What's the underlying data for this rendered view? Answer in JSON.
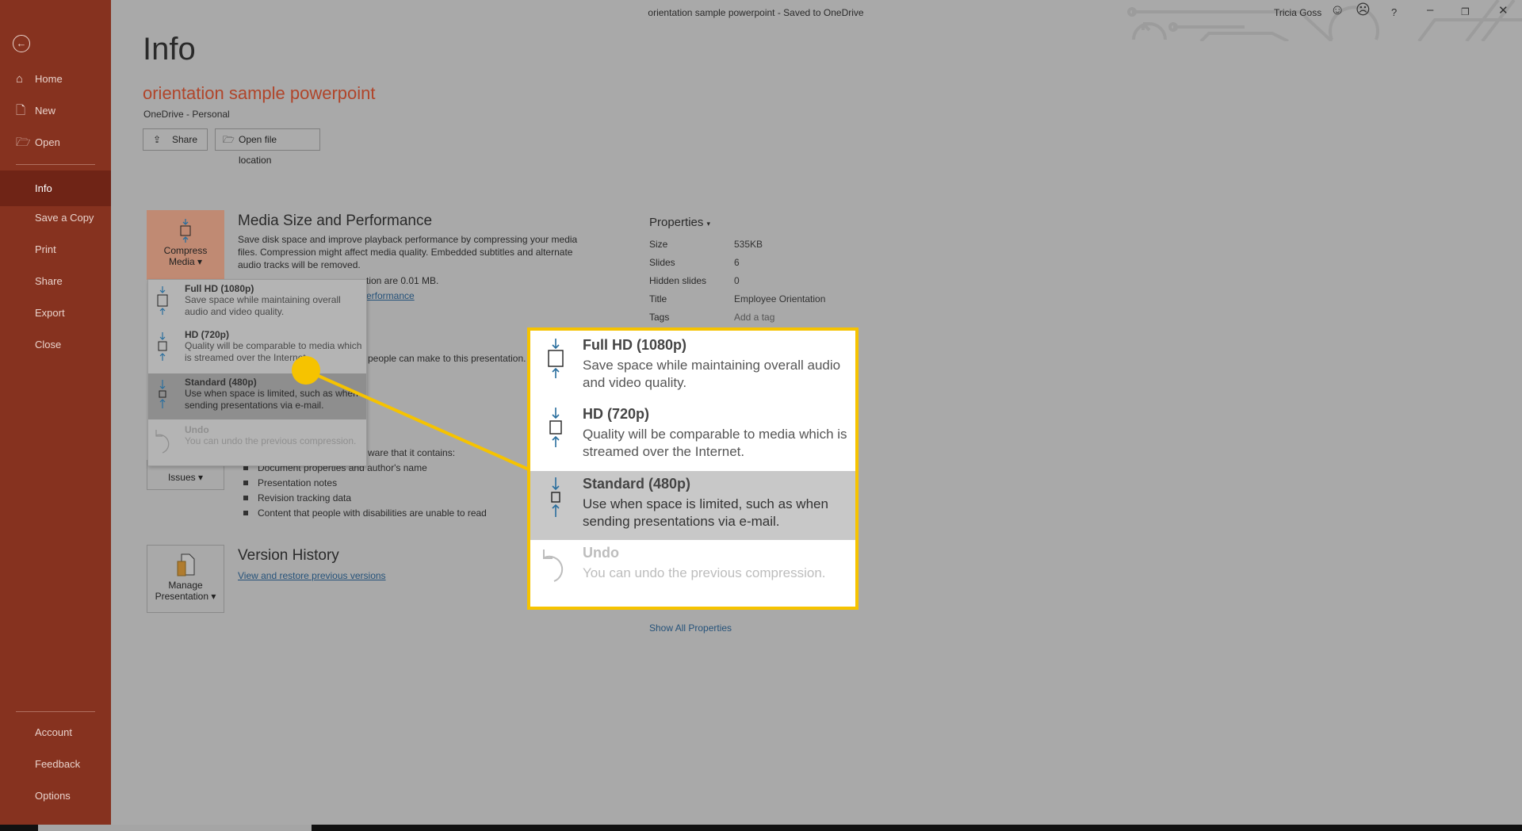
{
  "window": {
    "title": "orientation sample powerpoint  -  Saved to OneDrive",
    "user": "Tricia Goss",
    "help": "?"
  },
  "sidebar": {
    "items": [
      {
        "label": "Home",
        "icon": "home-icon"
      },
      {
        "label": "New",
        "icon": "new-file-icon"
      },
      {
        "label": "Open",
        "icon": "folder-open-icon"
      },
      {
        "label": "Info",
        "selected": true
      },
      {
        "label": "Save a Copy"
      },
      {
        "label": "Print"
      },
      {
        "label": "Share"
      },
      {
        "label": "Export"
      },
      {
        "label": "Close"
      }
    ],
    "bottom": [
      {
        "label": "Account"
      },
      {
        "label": "Feedback"
      },
      {
        "label": "Options"
      }
    ]
  },
  "main": {
    "heading": "Info",
    "doc_name": "orientation sample powerpoint",
    "location": "OneDrive - Personal",
    "share_label": "Share",
    "open_location_label": "Open file location",
    "media": {
      "button": "Compress",
      "button2": "Media",
      "title": "Media Size and Performance",
      "desc": [
        "Save disk space and improve playback performance by compressing your media",
        "files. Compression might affect media quality. Embedded subtitles and alternate",
        "audio tracks will be removed."
      ],
      "size_fragment": "tion are 0.01 MB.",
      "link_fragment": "erformance"
    },
    "protect_fragment": "people can make to this presentation.",
    "inspect": {
      "button": "Issues",
      "intro_fragment": "ware that it contains:",
      "bullets": [
        "Document properties and author's name",
        "Presentation notes",
        "Revision tracking data",
        "Content that people with disabilities are unable to read"
      ]
    },
    "version": {
      "button": "Manage",
      "button2": "Presentation",
      "title": "Version History",
      "link": "View and restore previous versions"
    }
  },
  "properties": {
    "title": "Properties",
    "rows": [
      {
        "label": "Size",
        "value": "535KB"
      },
      {
        "label": "Slides",
        "value": "6"
      },
      {
        "label": "Hidden slides",
        "value": "0"
      },
      {
        "label": "Title",
        "value": "Employee Orientation"
      },
      {
        "label": "Tags",
        "value": "Add a tag"
      }
    ],
    "show_all": "Show All Properties"
  },
  "compress_menu": {
    "items": [
      {
        "title": "Full HD (1080p)",
        "desc": "Save space while maintaining overall audio and video quality."
      },
      {
        "title": "HD (720p)",
        "desc": "Quality will be comparable to media which is streamed over the Internet."
      },
      {
        "title": "Standard (480p)",
        "desc": "Use when space is limited, such as when sending presentations via e-mail.",
        "highlighted": true
      },
      {
        "title": "Undo",
        "desc": "You can undo the previous compression.",
        "disabled": true
      }
    ]
  },
  "colors": {
    "sidebar": "#86321f",
    "accent": "#c0583a",
    "callout_border": "#f6c300",
    "link": "#25527a"
  }
}
